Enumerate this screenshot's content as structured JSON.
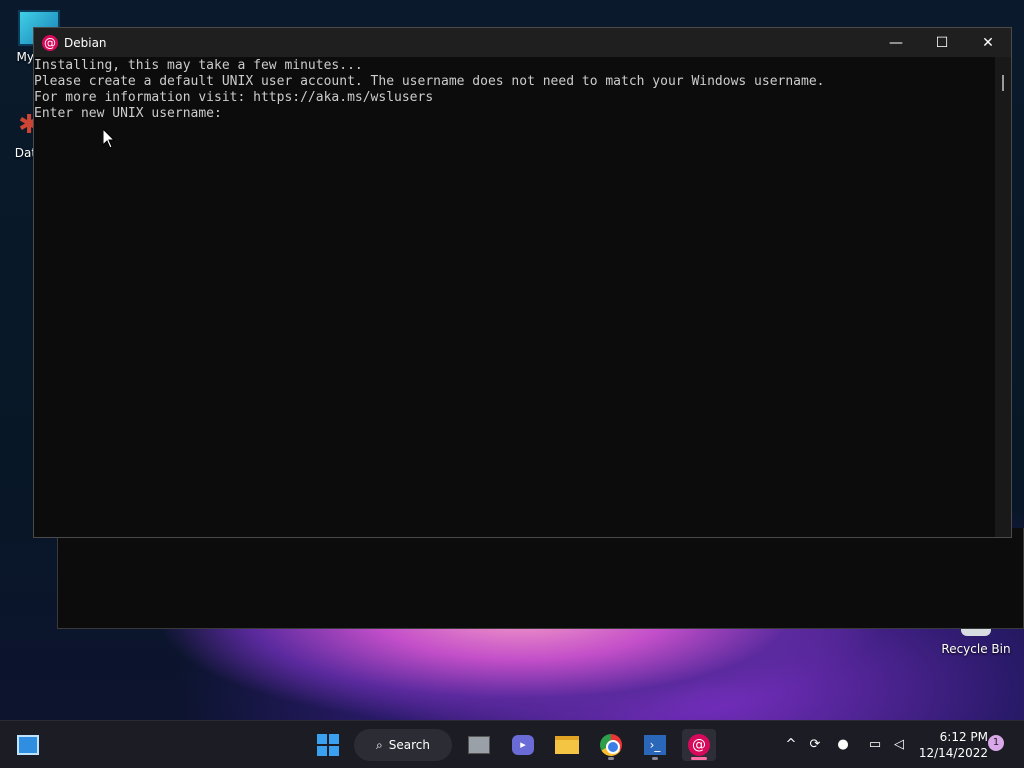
{
  "desktop": {
    "icons": [
      {
        "label": "My Co"
      },
      {
        "label": "DataW"
      },
      {
        "label": "Recycle Bin"
      }
    ]
  },
  "terminal": {
    "title": "Debian",
    "lines": [
      "Installing, this may take a few minutes...",
      "Please create a default UNIX user account. The username does not need to match your Windows username.",
      "For more information visit: https://aka.ms/wslusers",
      "Enter new UNIX username: "
    ],
    "controls": {
      "minimize": "—",
      "maximize": "☐",
      "close": "✕"
    }
  },
  "taskbar": {
    "search_label": "Search",
    "clock_time": "6:12 PM",
    "clock_date": "12/14/2022",
    "notification_count": "1"
  }
}
